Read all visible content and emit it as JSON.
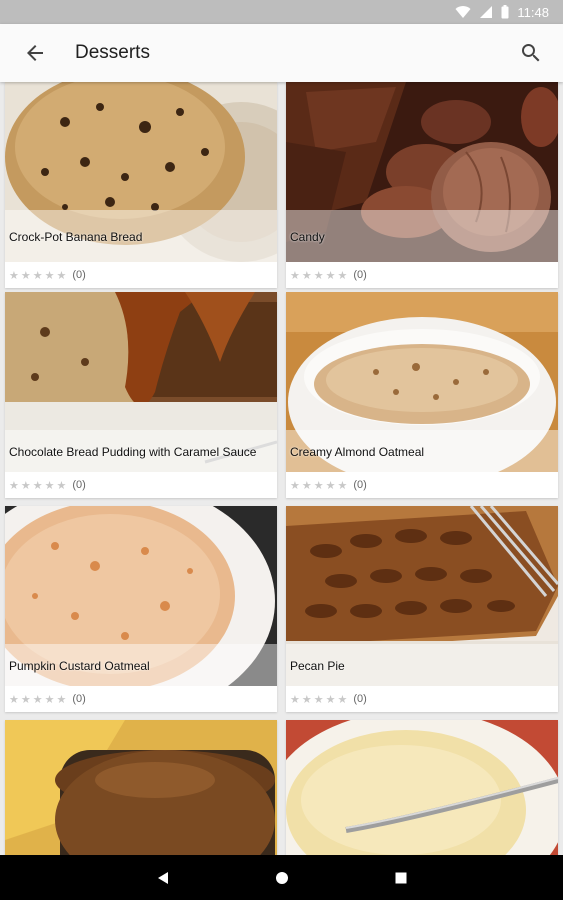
{
  "status": {
    "time": "11:48"
  },
  "appbar": {
    "title": "Desserts"
  },
  "recipes": [
    {
      "name": "Crock-Pot Banana Bread",
      "rating_count": "(0)"
    },
    {
      "name": "Candy",
      "rating_count": "(0)"
    },
    {
      "name": "Chocolate Bread Pudding with Caramel Sauce",
      "rating_count": "(0)"
    },
    {
      "name": "Creamy Almond Oatmeal",
      "rating_count": "(0)"
    },
    {
      "name": "Pumpkin Custard Oatmeal",
      "rating_count": "(0)"
    },
    {
      "name": "Pecan Pie",
      "rating_count": "(0)"
    },
    {
      "name": "",
      "rating_count": ""
    },
    {
      "name": "",
      "rating_count": ""
    }
  ],
  "icons": {
    "back": "arrow-back-icon",
    "search": "search-icon",
    "nav_back": "triangle-back-icon",
    "nav_home": "circle-home-icon",
    "nav_recent": "square-recent-icon"
  },
  "colors": {
    "statusbar": "#bdbdbd",
    "appbar": "#fafafa",
    "background": "#ebebeb",
    "navbar": "#000000"
  }
}
